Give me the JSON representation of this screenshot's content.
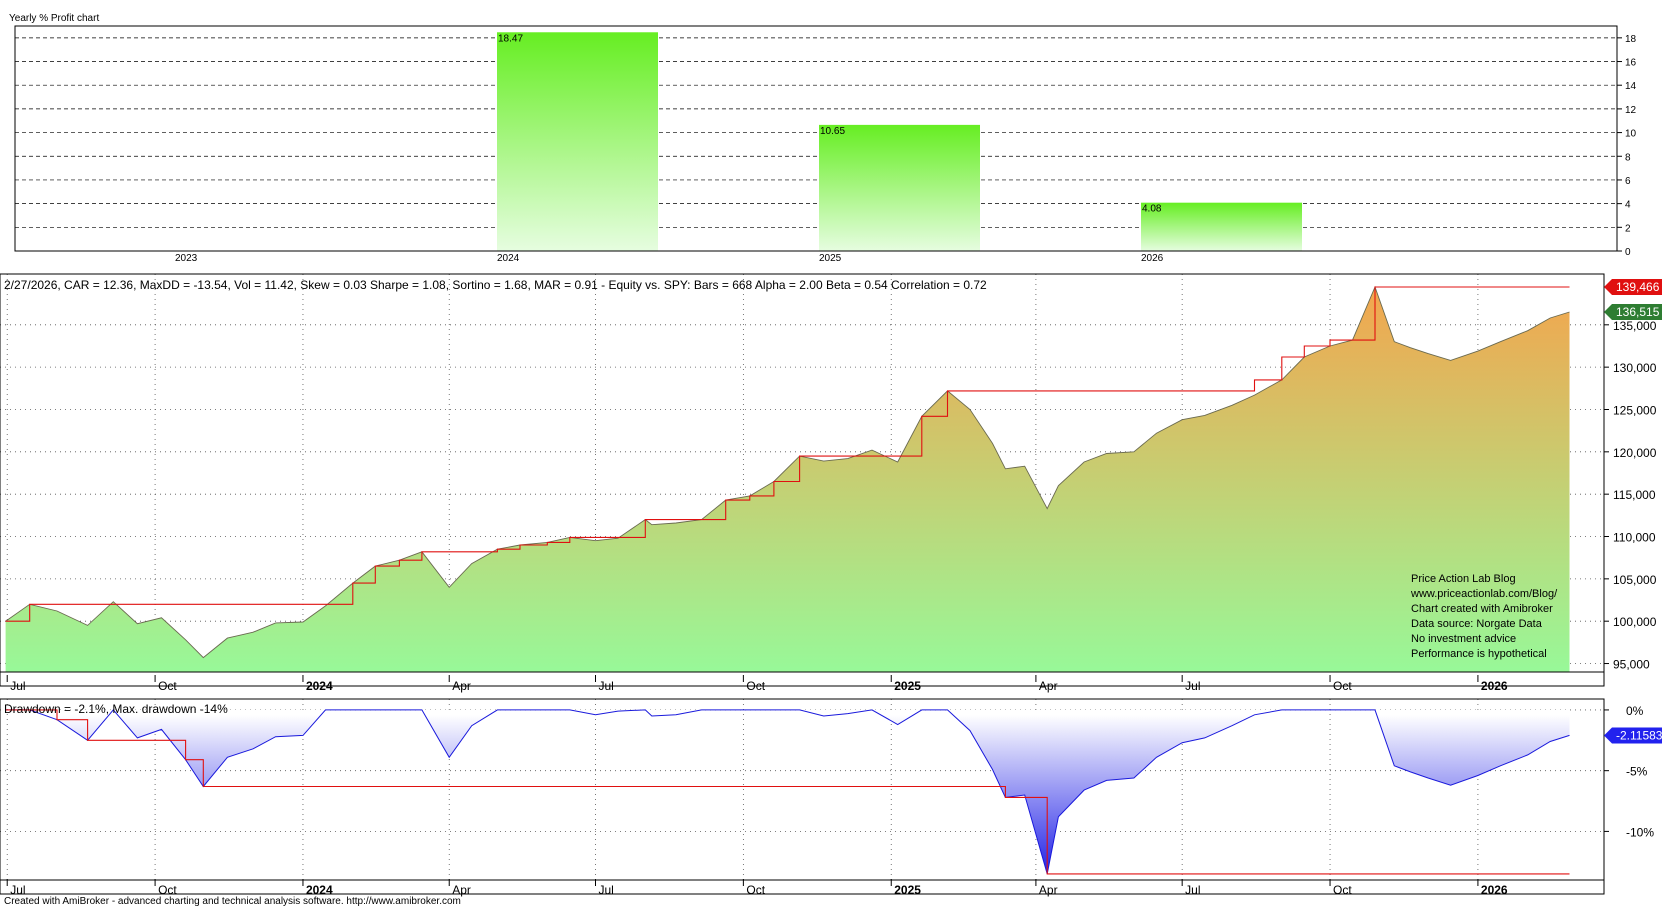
{
  "profit_panel": {
    "title": "Yearly % Profit chart"
  },
  "equity_panel": {
    "header": "2/27/2026, CAR = 12.36, MaxDD = -13.54, Vol = 11.42, Skew = 0.03 Sharpe = 1.08, Sortino = 1.68, MAR = 0.91 - Equity vs. SPY:  Bars = 668 Alpha = 2.00 Beta = 0.54 Correlation = 0.72",
    "last_high_label": "139,466",
    "last_value_label": "136,515",
    "high_color": "#e01010",
    "last_color": "#2e7d32",
    "notes": [
      "Price Action Lab Blog",
      "www.priceactionlab.com/Blog/",
      "Chart created with Amibroker",
      "Data source: Norgate Data",
      "No investment advice",
      "Performance is hypothetical"
    ]
  },
  "drawdown_panel": {
    "header": "Drawdown = -2.1%, Max. drawdown -14%",
    "last_value_label": "-2.11583",
    "last_color": "#2222ee"
  },
  "footer": "Created with AmiBroker - advanced charting and technical analysis software. http://www.amibroker.com",
  "chart_data": [
    {
      "type": "bar",
      "title": "Yearly % Profit chart",
      "categories": [
        "2023",
        "2024",
        "2025",
        "2026"
      ],
      "values": [
        0,
        18.47,
        10.65,
        4.08
      ],
      "data_labels": [
        "",
        "18.47",
        "10.65",
        "4.08"
      ],
      "y_ticks": [
        0,
        2,
        4,
        6,
        8,
        10,
        12,
        14,
        16,
        18
      ],
      "ylim": [
        0,
        19
      ],
      "grid": true,
      "bar_color_top": "#66ee22",
      "bar_color_bottom": "#e6fde0"
    },
    {
      "type": "area",
      "series": [
        {
          "name": "Equity",
          "x": [
            "2023-06-30",
            "2023-07-15",
            "2023-08-01",
            "2023-08-20",
            "2023-09-05",
            "2023-09-20",
            "2023-10-05",
            "2023-10-20",
            "2023-10-31",
            "2023-11-15",
            "2023-12-01",
            "2023-12-15",
            "2024-01-01",
            "2024-01-15",
            "2024-02-01",
            "2024-02-15",
            "2024-03-01",
            "2024-03-15",
            "2024-04-01",
            "2024-04-15",
            "2024-05-01",
            "2024-05-15",
            "2024-06-01",
            "2024-06-15",
            "2024-07-01",
            "2024-07-15",
            "2024-08-01",
            "2024-08-05",
            "2024-08-20",
            "2024-09-05",
            "2024-09-20",
            "2024-10-05",
            "2024-10-20",
            "2024-11-05",
            "2024-11-20",
            "2024-12-05",
            "2024-12-20",
            "2025-01-05",
            "2025-01-20",
            "2025-02-05",
            "2025-02-19",
            "2025-03-05",
            "2025-03-13",
            "2025-03-25",
            "2025-04-08",
            "2025-04-15",
            "2025-05-01",
            "2025-05-15",
            "2025-06-01",
            "2025-06-15",
            "2025-07-01",
            "2025-07-15",
            "2025-08-01",
            "2025-08-15",
            "2025-09-01",
            "2025-09-15",
            "2025-10-01",
            "2025-10-15",
            "2025-10-29",
            "2025-11-10",
            "2025-11-20",
            "2025-12-01",
            "2025-12-15",
            "2026-01-01",
            "2026-01-15",
            "2026-02-01",
            "2026-02-15",
            "2026-02-27"
          ],
          "values": [
            100000,
            102000,
            101200,
            99500,
            102300,
            99700,
            100400,
            97800,
            95700,
            98000,
            98700,
            99800,
            99900,
            101800,
            104500,
            106500,
            107200,
            108200,
            104000,
            106800,
            108500,
            109000,
            109300,
            109900,
            109500,
            109800,
            112000,
            111400,
            111600,
            112000,
            114300,
            114800,
            116500,
            119500,
            118900,
            119200,
            120200,
            118800,
            124200,
            127200,
            125000,
            121000,
            118000,
            118300,
            113300,
            116000,
            118800,
            119800,
            120000,
            122200,
            123800,
            124300,
            125500,
            126700,
            128500,
            131200,
            132500,
            133200,
            139466,
            133000,
            132300,
            131600,
            130800,
            131900,
            133000,
            134300,
            135800,
            136515
          ]
        },
        {
          "name": "New equity high",
          "x": [
            "2023-06-30",
            "2023-07-15",
            "2024-01-15",
            "2024-02-01",
            "2024-02-15",
            "2024-03-01",
            "2024-03-15",
            "2024-05-01",
            "2024-05-15",
            "2024-06-01",
            "2024-06-15",
            "2024-08-01",
            "2024-09-20",
            "2024-10-05",
            "2024-10-20",
            "2024-11-05",
            "2025-01-20",
            "2025-02-05",
            "2025-07-01",
            "2025-08-15",
            "2025-09-01",
            "2025-09-15",
            "2025-10-01",
            "2025-10-15",
            "2025-10-29",
            "2026-02-27"
          ],
          "values": [
            100000,
            102000,
            102000,
            104500,
            106500,
            107200,
            108200,
            108500,
            109000,
            109300,
            109900,
            112000,
            114300,
            114800,
            116500,
            119500,
            124200,
            127200,
            127200,
            128500,
            131200,
            132500,
            133200,
            133200,
            139466,
            139466
          ]
        }
      ],
      "y_ticks": [
        95000,
        100000,
        105000,
        110000,
        115000,
        120000,
        125000,
        130000,
        135000
      ],
      "y_tick_labels": [
        "95,000",
        "100,000",
        "105,000",
        "110,000",
        "115,000",
        "120,000",
        "125,000",
        "130,000",
        "135,000"
      ],
      "ylim": [
        94000,
        141000
      ],
      "xlim": [
        "2023-06-29",
        "2026-03-08"
      ],
      "x_ticks": [
        "2023-07-01",
        "2023-10-01",
        "2024-01-01",
        "2024-04-01",
        "2024-07-01",
        "2024-10-01",
        "2025-01-01",
        "2025-04-01",
        "2025-07-01",
        "2025-10-01",
        "2026-01-01"
      ],
      "x_tick_labels": [
        "Jul",
        "Oct",
        "2024",
        "Apr",
        "Jul",
        "Oct",
        "2025",
        "Apr",
        "Jul",
        "Oct",
        "2026"
      ],
      "grid": true,
      "fill_top": "#f0a850",
      "fill_bottom": "#98f898"
    },
    {
      "type": "area",
      "series": [
        {
          "name": "Drawdown",
          "x": [
            "2023-06-30",
            "2023-07-15",
            "2023-08-01",
            "2023-08-20",
            "2023-09-05",
            "2023-09-20",
            "2023-10-05",
            "2023-10-20",
            "2023-10-31",
            "2023-11-15",
            "2023-12-01",
            "2023-12-15",
            "2024-01-01",
            "2024-01-15",
            "2024-02-01",
            "2024-02-15",
            "2024-03-01",
            "2024-03-15",
            "2024-04-01",
            "2024-04-15",
            "2024-05-01",
            "2024-05-15",
            "2024-06-01",
            "2024-06-15",
            "2024-07-01",
            "2024-07-15",
            "2024-08-01",
            "2024-08-05",
            "2024-08-20",
            "2024-09-05",
            "2024-09-20",
            "2024-10-05",
            "2024-10-20",
            "2024-11-05",
            "2024-11-20",
            "2024-12-05",
            "2024-12-20",
            "2025-01-05",
            "2025-01-20",
            "2025-02-05",
            "2025-02-19",
            "2025-03-05",
            "2025-03-13",
            "2025-03-25",
            "2025-04-08",
            "2025-04-15",
            "2025-05-01",
            "2025-05-15",
            "2025-06-01",
            "2025-06-15",
            "2025-07-01",
            "2025-07-15",
            "2025-08-01",
            "2025-08-15",
            "2025-09-01",
            "2025-09-15",
            "2025-10-01",
            "2025-10-15",
            "2025-10-29",
            "2025-11-10",
            "2025-11-20",
            "2025-12-01",
            "2025-12-15",
            "2026-01-01",
            "2026-01-15",
            "2026-02-01",
            "2026-02-15",
            "2026-02-27"
          ],
          "values": [
            0,
            0,
            -0.8,
            -2.5,
            0,
            -2.3,
            -1.6,
            -4.1,
            -6.3,
            -3.9,
            -3.2,
            -2.2,
            -2.1,
            0,
            0,
            0,
            0,
            0,
            -3.9,
            -1.3,
            0,
            0,
            0,
            0,
            -0.4,
            -0.1,
            0,
            -0.5,
            -0.4,
            0,
            0,
            0,
            0,
            0,
            -0.5,
            -0.3,
            0,
            -1.2,
            0,
            0,
            -1.7,
            -4.9,
            -7.2,
            -7.0,
            -13.5,
            -8.8,
            -6.6,
            -5.8,
            -5.6,
            -3.9,
            -2.7,
            -2.3,
            -1.3,
            -0.4,
            0,
            0,
            0,
            0,
            0,
            -4.6,
            -5.1,
            -5.6,
            -6.2,
            -5.4,
            -4.6,
            -3.7,
            -2.6,
            -2.1
          ]
        },
        {
          "name": "Max. drawdown",
          "x": [
            "2023-06-30",
            "2023-07-15",
            "2023-08-01",
            "2023-08-20",
            "2023-10-20",
            "2023-10-31",
            "2025-03-13",
            "2025-04-08",
            "2026-02-27"
          ],
          "values": [
            0,
            0,
            -0.8,
            -2.5,
            -4.1,
            -6.3,
            -7.2,
            -13.5,
            -13.5
          ]
        }
      ],
      "y_ticks": [
        0,
        -5,
        -10
      ],
      "y_tick_labels": [
        "0%",
        "-5%",
        "-10%"
      ],
      "ylim": [
        -14,
        0.9
      ],
      "xlim": [
        "2023-06-29",
        "2026-03-08"
      ],
      "x_ticks": [
        "2023-07-01",
        "2023-10-01",
        "2024-01-01",
        "2024-04-01",
        "2024-07-01",
        "2024-10-01",
        "2025-01-01",
        "2025-04-01",
        "2025-07-01",
        "2025-10-01",
        "2026-01-01"
      ],
      "x_tick_labels": [
        "Jul",
        "Oct",
        "2024",
        "Apr",
        "Jul",
        "Oct",
        "2025",
        "Apr",
        "Jul",
        "Oct",
        "2026"
      ],
      "grid": true,
      "fill_top": "#ffffff",
      "fill_bottom": "#2020e6"
    }
  ]
}
